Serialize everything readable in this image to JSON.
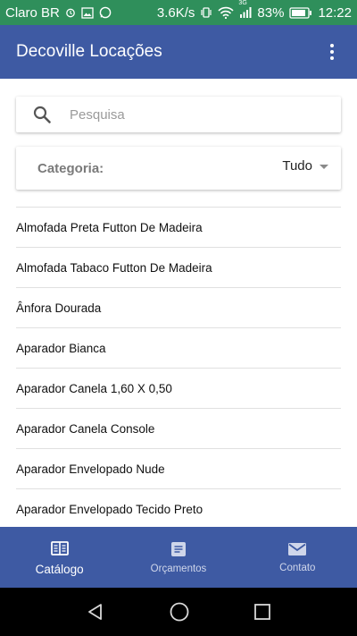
{
  "status_bar": {
    "carrier": "Claro BR",
    "network_speed": "3.6K/s",
    "signal_tag": "3G",
    "battery": "83%",
    "time": "12:22"
  },
  "app_bar": {
    "title": "Decoville Locações",
    "menu_icon": "more-vertical-icon"
  },
  "search": {
    "placeholder": "Pesquisa",
    "value": "",
    "icon": "search-icon"
  },
  "category": {
    "label": "Categoria:",
    "selected": "Tudo"
  },
  "products": [
    "Almofada Preta Futton De Madeira",
    "Almofada Tabaco Futton De Madeira",
    "Ânfora Dourada",
    "Aparador Bianca",
    "Aparador Canela 1,60 X 0,50",
    "Aparador Canela Console",
    "Aparador Envelopado Nude",
    "Aparador Envelopado Tecido Preto"
  ],
  "bottom_nav": {
    "tabs": [
      {
        "label": "Catálogo",
        "icon": "catalog-icon",
        "active": true
      },
      {
        "label": "Orçamentos",
        "icon": "quote-icon",
        "active": false
      },
      {
        "label": "Contato",
        "icon": "mail-icon",
        "active": false
      }
    ]
  },
  "colors": {
    "primary": "#3e5aa3",
    "status_bar": "#2f8f5b"
  }
}
